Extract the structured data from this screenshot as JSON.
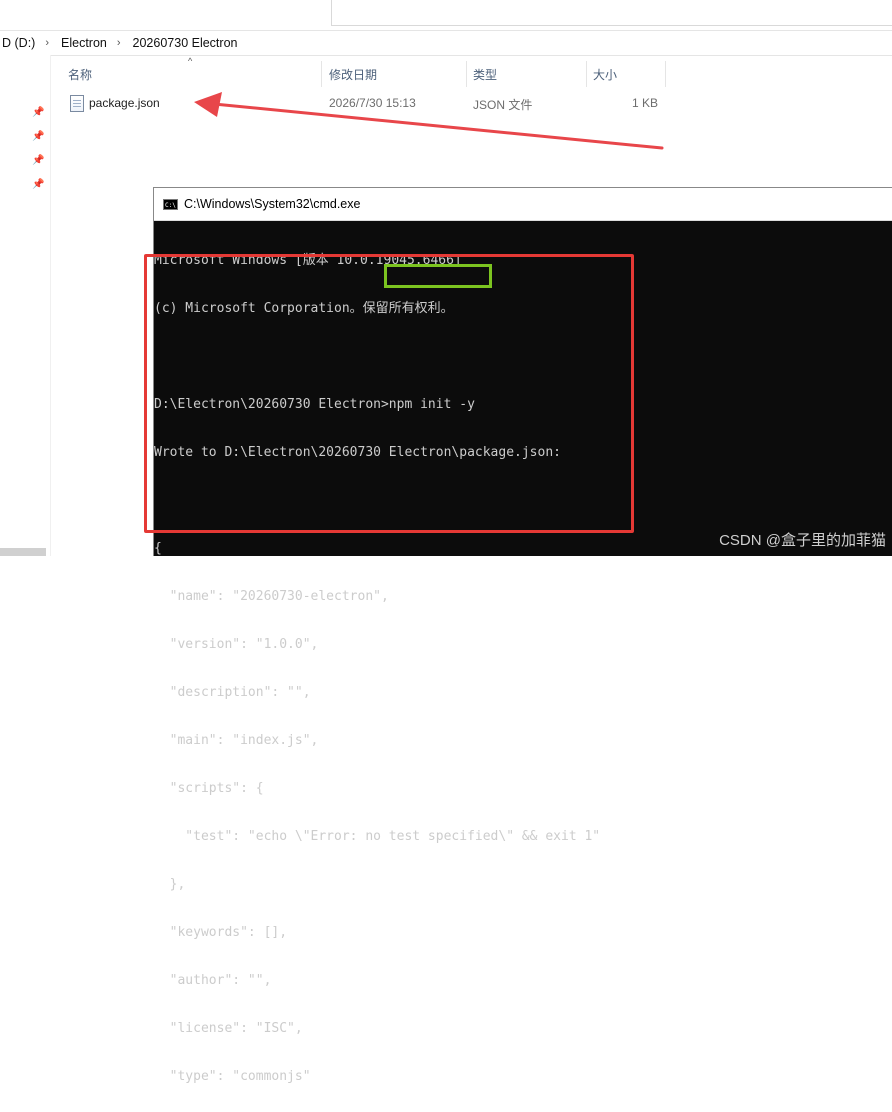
{
  "explorer": {
    "breadcrumb": [
      "D (D:)",
      "Electron",
      "20260730 Electron"
    ],
    "breadcrumb_separator": "›",
    "columns": {
      "name": "名称",
      "modified": "修改日期",
      "type": "类型",
      "size": "大小"
    },
    "files": [
      {
        "name": "package.json",
        "modified": "2026/7/30 15:13",
        "type": "JSON 文件",
        "size": "1 KB",
        "icon": "json-file-icon"
      }
    ]
  },
  "cmd": {
    "title": "C:\\Windows\\System32\\cmd.exe",
    "icon_text": "C:\\",
    "lines": [
      "Microsoft Windows [版本 10.0.19045.6466]",
      "(c) Microsoft Corporation。保留所有权利。",
      "",
      "D:\\Electron\\20260730 Electron>npm init -y",
      "Wrote to D:\\Electron\\20260730 Electron\\package.json:",
      "",
      "{",
      "  \"name\": \"20260730-electron\",",
      "  \"version\": \"1.0.0\",",
      "  \"description\": \"\",",
      "  \"main\": \"index.js\",",
      "  \"scripts\": {",
      "    \"test\": \"echo \\\"Error: no test specified\\\" && exit 1\"",
      "  },",
      "  \"keywords\": [],",
      "  \"author\": \"\",",
      "  \"license\": \"ISC\",",
      "  \"type\": \"commonjs\"",
      "}"
    ]
  },
  "annotations": {
    "arrow_color": "#e8464a",
    "red_box_color": "#e53935",
    "green_box_color": "#7cc420"
  },
  "watermark": "CSDN @盒子里的加菲猫"
}
